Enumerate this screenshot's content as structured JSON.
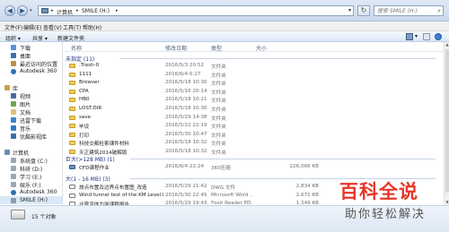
{
  "address": {
    "crumbs": [
      "计算机",
      "SMILE (H:)"
    ],
    "search_placeholder": "搜索 SMILE (H:)"
  },
  "menu": [
    "文件(F)",
    "编辑(E)",
    "查看(V)",
    "工具(T)",
    "帮助(H)"
  ],
  "toolbar": {
    "organize": "组织 ▾",
    "share": "共享 ▾",
    "new_folder": "新建文件夹"
  },
  "columns": {
    "name": "名称",
    "date": "修改日期",
    "type": "类型",
    "size": "大小"
  },
  "nav": {
    "favorites": [
      "下载",
      "桌面",
      "最近访问的位置",
      "Autodesk 360"
    ],
    "library_label": "库",
    "libraries": [
      "视频",
      "图片",
      "文档",
      "迅雷下载",
      "音乐",
      "优酷影视库"
    ],
    "computer_label": "计算机",
    "drives": [
      "系统盘 (C:)",
      "科研 (D:)",
      "学习 (E:)",
      "娱乐 (F:)",
      "Autodesk 360",
      "SMILE (H:)"
    ]
  },
  "groups": {
    "unspecified": "未指定 (11)",
    "huge": "巨大(>128 MB) (1)",
    "large": "大(1 - 16 MB) (3)"
  },
  "files_unspecified": [
    {
      "name": ".Trash-0",
      "date": "2016/5/3 20:52",
      "type": "文件夹",
      "size": ""
    },
    {
      "name": "1111",
      "date": "2016/6/4 0:27",
      "type": "文件夹",
      "size": ""
    },
    {
      "name": "Browser",
      "date": "2016/5/18 10:30",
      "type": "文件夹",
      "size": ""
    },
    {
      "name": "CPA",
      "date": "2016/5/16 20:14",
      "type": "文件夹",
      "size": ""
    },
    {
      "name": "HB0",
      "date": "2016/5/18 10:21",
      "type": "文件夹",
      "size": ""
    },
    {
      "name": "LOST.DIR",
      "date": "2016/5/18 10:30",
      "type": "文件夹",
      "size": ""
    },
    {
      "name": "save",
      "date": "2016/5/29 14:38",
      "type": "文件夹",
      "size": ""
    },
    {
      "name": "毕设",
      "date": "2016/5/22 22:19",
      "type": "文件夹",
      "size": ""
    },
    {
      "name": "打印",
      "date": "2016/5/30 10:47",
      "type": "文件夹",
      "size": ""
    },
    {
      "name": "科技交都检索课件材料",
      "date": "2016/5/18 10:32",
      "type": "文件夹",
      "size": ""
    },
    {
      "name": "天正建筑2014破解版",
      "date": "2016/5/18 10:32",
      "type": "文件夹",
      "size": ""
    }
  ],
  "files_huge": [
    {
      "name": "CFD课程作业",
      "date": "2016/6/4 22:24",
      "type": "360压缩",
      "size": "226,066 KB"
    }
  ],
  "files_large": [
    {
      "name": "旅点布置及边界点布置图_改造",
      "date": "2016/5/29 21:42",
      "type": "DWG 文件",
      "size": "2,834 KB"
    },
    {
      "name": "Wind tunnel test of the KM Level hig...",
      "date": "2016/5/30 22:45",
      "type": "Microsoft Word ...",
      "size": "2,671 KB"
    },
    {
      "name": "计算流体力学课程报告",
      "date": "2016/5/29 19:43",
      "type": "Foxit Reader PD...",
      "size": "1,349 KB"
    }
  ],
  "status": {
    "count": "15 个对象"
  },
  "watermark": {
    "line1": "百科全说",
    "line2": "助你轻松解决"
  },
  "colors": {
    "folder": "#f2cc5a",
    "group_header": "#1e3287",
    "watermark_red": "#e8362a"
  }
}
